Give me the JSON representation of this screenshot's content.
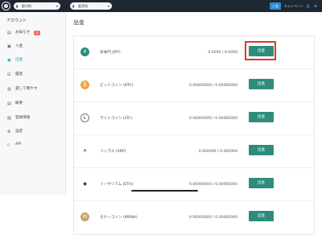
{
  "topbar": {
    "exchange_label": "取引所",
    "exchange_icon": "chart-bars-icon",
    "sales_label": "販売所",
    "sales_icon": "chart-bars-icon",
    "deposit_button": "入金",
    "campaign_label": "キャンペーン",
    "accent_color": "#2d8bd6"
  },
  "sidebar": {
    "title": "アカウント",
    "items": [
      {
        "label": "お知らせ",
        "icon": "message-icon",
        "badge": "2"
      },
      {
        "label": "入金",
        "icon": "deposit-icon"
      },
      {
        "label": "出金",
        "icon": "withdraw-icon",
        "active": true
      },
      {
        "label": "履歴",
        "icon": "history-icon"
      },
      {
        "label": "貸して増やす",
        "icon": "lend-icon"
      },
      {
        "label": "概要",
        "icon": "overview-icon"
      },
      {
        "label": "登録情報",
        "icon": "profile-icon"
      },
      {
        "label": "設定",
        "icon": "gear-icon"
      },
      {
        "label": "API",
        "icon": "api-icon"
      }
    ]
  },
  "main": {
    "title": "出金",
    "rows": [
      {
        "symbol": "¥",
        "name": "日本円 (JPY)",
        "amount": "0.0000 / 0.0000",
        "button": "出金",
        "color": "#2e8d7a"
      },
      {
        "symbol": "₿",
        "name": "ビットコイン (BTC)",
        "amount": "0.00000000 / 0.00000000",
        "button": "出金",
        "color": "#f2a23a"
      },
      {
        "symbol": "Ł",
        "name": "ライトコイン (LTC)",
        "amount": "0.00000000 / 0.00000000",
        "button": "出金",
        "color": "#ffffff"
      },
      {
        "symbol": "✕",
        "name": "リップル (XRP)",
        "amount": "0.000000 / 0.000000",
        "button": "出金",
        "color": "#ffffff"
      },
      {
        "symbol": "◆",
        "name": "イーサリアム (ETH)",
        "amount": "0.00000000 / 0.00000000",
        "button": "出金",
        "color": "#ffffff"
      },
      {
        "symbol": "M",
        "name": "モナーコイン (MONA)",
        "amount": "0.00000000 / 0.00000000",
        "button": "出金",
        "color": "#c8a46a"
      }
    ]
  }
}
